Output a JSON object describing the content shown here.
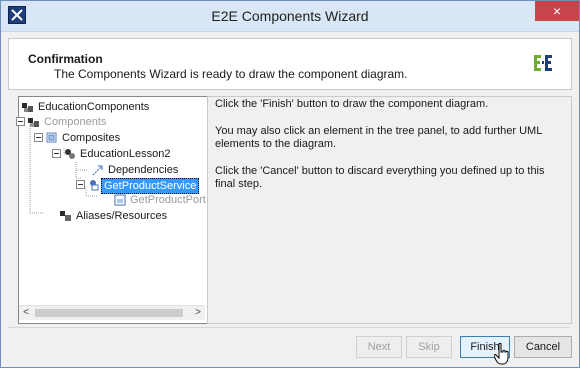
{
  "window": {
    "title": "E2E Components Wizard",
    "close_glyph": "×"
  },
  "header": {
    "title": "Confirmation",
    "subtitle": "The Components Wizard is ready to draw the component diagram.",
    "logo_icon": "e2e-logo-icon"
  },
  "tree": {
    "items": [
      {
        "label": "EducationComponents",
        "icon": "package-icon"
      },
      {
        "label": "Components",
        "icon": "components-icon"
      },
      {
        "label": "Composites",
        "icon": "composites-icon"
      },
      {
        "label": "EducationLesson2",
        "icon": "component-icon"
      },
      {
        "label": "Dependencies",
        "icon": "dependency-icon"
      },
      {
        "label": "GetProductService",
        "icon": "service-icon"
      },
      {
        "label": "GetProductPort",
        "icon": "port-icon"
      },
      {
        "label": "Aliases/Resources",
        "icon": "aliases-icon"
      }
    ],
    "scroll_left": "<",
    "scroll_right": ">"
  },
  "info": {
    "p1": "Click the 'Finish' button to draw the component diagram.",
    "p2": "You may also click an element in the tree panel, to add further UML elements to the diagram.",
    "p3": "Click the 'Cancel' button to discard everything you defined up to this final step."
  },
  "buttons": {
    "next": "Next",
    "skip": "Skip",
    "finish": "Finish",
    "cancel": "Cancel"
  },
  "colors": {
    "selection": "#3399ff",
    "close": "#c9444a",
    "titlebar": "#d9e6f5"
  }
}
